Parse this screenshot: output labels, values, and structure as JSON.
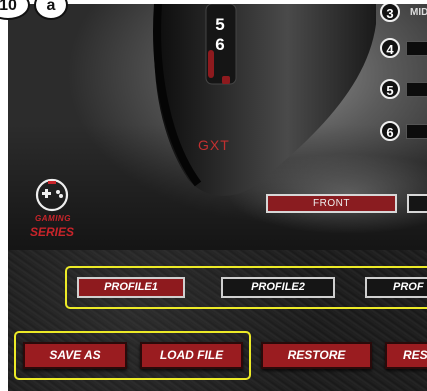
{
  "step_badges": [
    "10",
    "a"
  ],
  "mouse": {
    "button_numbers": [
      "5",
      "6"
    ],
    "brand": "GXT"
  },
  "button_rows": [
    {
      "number": "3",
      "label": "MID"
    },
    {
      "number": "4",
      "label": ""
    },
    {
      "number": "5",
      "label": ""
    },
    {
      "number": "6",
      "label": ""
    }
  ],
  "view_tabs": {
    "front": "FRONT"
  },
  "logo": {
    "line1": "GAMING",
    "line2": "SERIES"
  },
  "profiles": [
    "PROFILE1",
    "PROFILE2",
    "PROF"
  ],
  "actions": [
    "SAVE AS",
    "LOAD FILE",
    "RESTORE",
    "RES"
  ],
  "colors": {
    "accent_red": "#9a1c20",
    "highlight_yellow": "#ecea27",
    "panel_dark": "#1e1e1e"
  }
}
